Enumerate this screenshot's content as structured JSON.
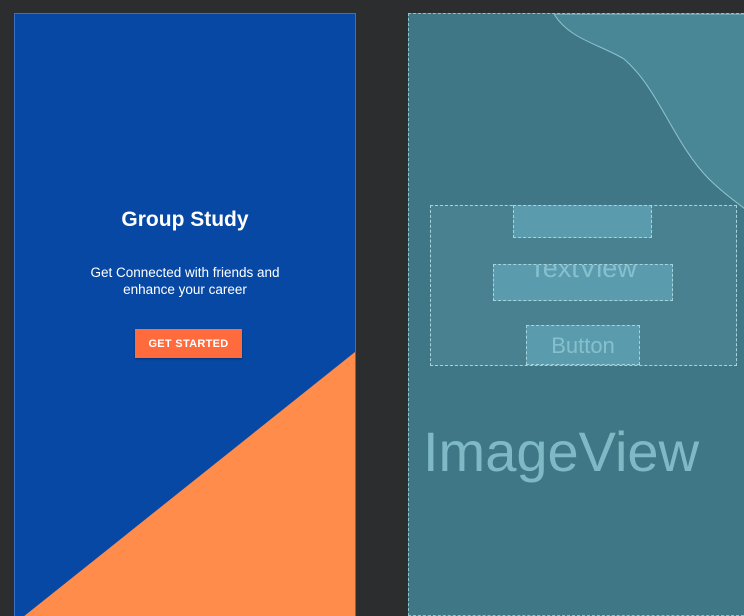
{
  "design_preview": {
    "title": "Group Study",
    "subtitle": "Get Connected with friends and enhance your career",
    "cta_label": "GET STARTED",
    "colors": {
      "background": "#0748a4",
      "accent_triangle": "#ff8c4a",
      "button": "#ff6b3d",
      "text": "#ffffff"
    }
  },
  "blueprint_preview": {
    "textview_label": "TextView",
    "button_label": "Button",
    "imageview_label": "ImageView",
    "colors": {
      "background": "#3f7786",
      "component_fill": "#5a9cad",
      "label": "#86c0cd"
    }
  },
  "workspace": {
    "background": "#2b2d2f"
  }
}
